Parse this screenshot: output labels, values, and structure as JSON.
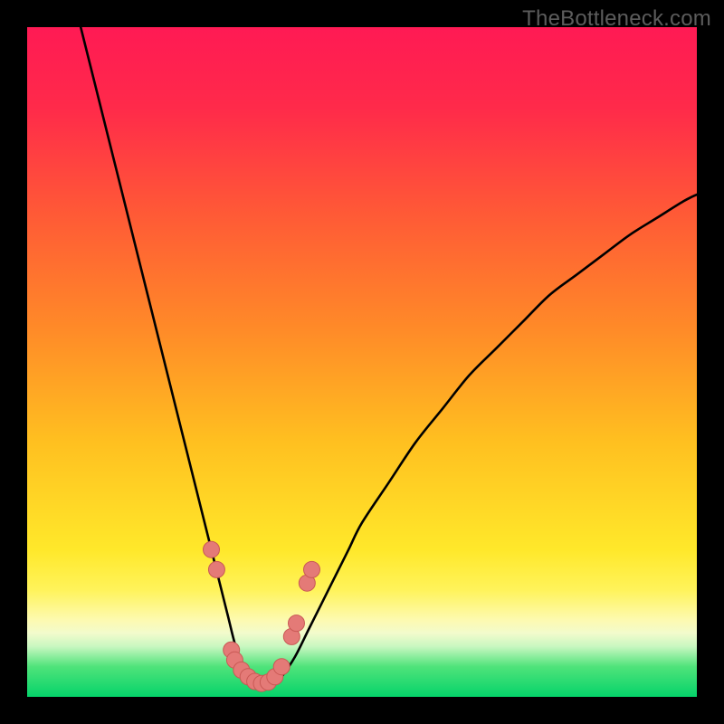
{
  "watermark": "TheBottleneck.com",
  "colors": {
    "frame": "#000000",
    "gradient_stops": [
      {
        "offset": 0.0,
        "color": "#ff1a54"
      },
      {
        "offset": 0.12,
        "color": "#ff2a4a"
      },
      {
        "offset": 0.28,
        "color": "#ff5a36"
      },
      {
        "offset": 0.45,
        "color": "#ff8a28"
      },
      {
        "offset": 0.62,
        "color": "#ffc020"
      },
      {
        "offset": 0.78,
        "color": "#ffe82a"
      },
      {
        "offset": 0.84,
        "color": "#fff35a"
      },
      {
        "offset": 0.885,
        "color": "#fdfab0"
      },
      {
        "offset": 0.905,
        "color": "#f2fbcc"
      },
      {
        "offset": 0.925,
        "color": "#c8f7c0"
      },
      {
        "offset": 0.955,
        "color": "#4fe37a"
      },
      {
        "offset": 1.0,
        "color": "#05d36a"
      }
    ],
    "curve": "#000000",
    "marker_fill": "#e47a77",
    "marker_stroke": "#c95955"
  },
  "chart_data": {
    "type": "line",
    "title": "",
    "xlabel": "",
    "ylabel": "",
    "xlim": [
      0,
      100
    ],
    "ylim": [
      0,
      100
    ],
    "series": [
      {
        "name": "bottleneck-curve",
        "x": [
          8,
          10,
          12,
          14,
          16,
          18,
          20,
          22,
          24,
          26,
          28,
          29,
          30,
          31,
          32,
          33,
          34,
          35,
          36,
          37,
          38,
          40,
          42,
          44,
          46,
          48,
          50,
          54,
          58,
          62,
          66,
          70,
          74,
          78,
          82,
          86,
          90,
          94,
          98,
          100
        ],
        "y": [
          100,
          92,
          84,
          76,
          68,
          60,
          52,
          44,
          36,
          28,
          20,
          16,
          12,
          8,
          5,
          3,
          2,
          1.5,
          1.5,
          2,
          3,
          6,
          10,
          14,
          18,
          22,
          26,
          32,
          38,
          43,
          48,
          52,
          56,
          60,
          63,
          66,
          69,
          71.5,
          74,
          75
        ]
      }
    ],
    "markers": [
      {
        "x": 27.5,
        "y": 22
      },
      {
        "x": 28.3,
        "y": 19
      },
      {
        "x": 30.5,
        "y": 7
      },
      {
        "x": 31.0,
        "y": 5.5
      },
      {
        "x": 32.0,
        "y": 4
      },
      {
        "x": 33.0,
        "y": 3
      },
      {
        "x": 34.0,
        "y": 2.3
      },
      {
        "x": 35.0,
        "y": 2
      },
      {
        "x": 36.0,
        "y": 2.2
      },
      {
        "x": 37.0,
        "y": 3
      },
      {
        "x": 38.0,
        "y": 4.5
      },
      {
        "x": 39.5,
        "y": 9
      },
      {
        "x": 40.2,
        "y": 11
      },
      {
        "x": 41.8,
        "y": 17
      },
      {
        "x": 42.5,
        "y": 19
      }
    ],
    "marker_radius_px": 9
  }
}
